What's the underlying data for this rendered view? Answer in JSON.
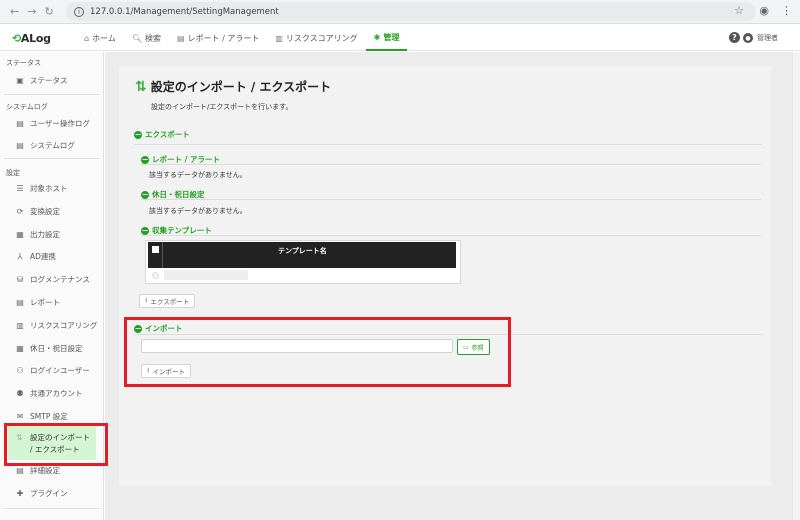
{
  "browser": {
    "url": "127.0.0.1/Management/SettingManagement"
  },
  "app": {
    "logo": "ALog",
    "nav": [
      {
        "label": "ホーム",
        "icon": "home-icon"
      },
      {
        "label": "検索",
        "icon": "search-icon"
      },
      {
        "label": "レポート / アラート",
        "icon": "report-icon"
      },
      {
        "label": "リスクスコアリング",
        "icon": "risk-icon"
      },
      {
        "label": "管理",
        "icon": "gear-icon"
      }
    ],
    "user": "管理者"
  },
  "sidebar": {
    "sections": [
      {
        "title": "ステータス",
        "items": [
          {
            "label": "ステータス",
            "icon": "status-icon"
          }
        ]
      },
      {
        "title": "システムログ",
        "items": [
          {
            "label": "ユーザー操作ログ",
            "icon": "log-icon"
          },
          {
            "label": "システムログ",
            "icon": "log-icon"
          }
        ]
      },
      {
        "title": "設定",
        "items": [
          {
            "label": "対象ホスト",
            "icon": "list-icon"
          },
          {
            "label": "変換設定",
            "icon": "refresh-icon"
          },
          {
            "label": "出力設定",
            "icon": "output-icon"
          },
          {
            "label": "AD連携",
            "icon": "sitemap-icon"
          },
          {
            "label": "ログメンテナンス",
            "icon": "database-icon"
          },
          {
            "label": "レポート",
            "icon": "report-icon"
          },
          {
            "label": "リスクスコアリング",
            "icon": "risk-icon"
          },
          {
            "label": "休日・祝日設定",
            "icon": "calendar-icon"
          },
          {
            "label": "ログインユーザー",
            "icon": "user-icon"
          },
          {
            "label": "共通アカウント",
            "icon": "account-icon"
          },
          {
            "label": "SMTP 設定",
            "icon": "mail-icon"
          }
        ]
      }
    ],
    "active_line1": "設定のインポート",
    "active_line2": "/ エクスポート",
    "after": [
      {
        "label": "詳細設定",
        "icon": "detail-icon"
      },
      {
        "label": "プラグイン",
        "icon": "puzzle-icon"
      }
    ]
  },
  "main": {
    "title": "設定のインポート / エクスポート",
    "description": "設定のインポート/エクスポートを行います。",
    "export": {
      "heading": "エクスポート",
      "report_heading": "レポート / アラート",
      "report_empty": "該当するデータがありません。",
      "holiday_heading": "休日・祝日設定",
      "holiday_empty": "該当するデータがありません。",
      "template_heading": "収集テンプレート",
      "template_column": "テンプレート名",
      "button": "エクスポート"
    },
    "import": {
      "heading": "インポート",
      "browse_button": "参照",
      "button": "インポート"
    }
  }
}
